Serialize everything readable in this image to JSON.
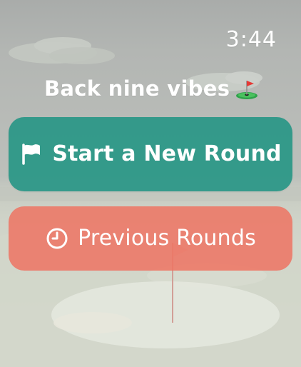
{
  "status_bar": {
    "time": "3:44"
  },
  "header": {
    "title": "Back nine vibes",
    "emoji_icon": "golf-flag-emoji"
  },
  "buttons": {
    "start": {
      "label": "Start a New Round",
      "icon": "flag-icon",
      "color": "#2a9787"
    },
    "previous": {
      "label": "Previous Rounds",
      "icon": "clock-icon",
      "color": "#ee7463"
    }
  }
}
